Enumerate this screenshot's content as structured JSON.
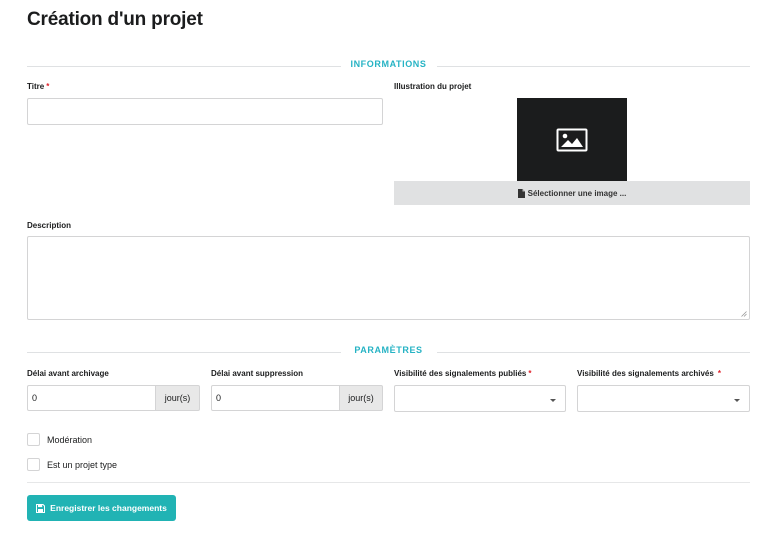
{
  "page": {
    "title": "Création d'un projet"
  },
  "sections": {
    "informations": "INFORMATIONS",
    "parametres": "PARAMÈTRES"
  },
  "fields": {
    "title": {
      "label": "Titre",
      "required_mark": "*",
      "value": ""
    },
    "illustration": {
      "label": "Illustration du projet",
      "button_label": "Sélectionner une image ..."
    },
    "description": {
      "label": "Description",
      "value": ""
    },
    "archive_delay": {
      "label": "Délai avant archivage",
      "value": "0",
      "unit": "jour(s)"
    },
    "delete_delay": {
      "label": "Délai avant suppression",
      "value": "0",
      "unit": "jour(s)"
    },
    "visibility_published": {
      "label": "Visibilité des signalements publiés",
      "required_mark": "*",
      "selected": ""
    },
    "visibility_archived": {
      "label": "Visibilité des signalements archivés",
      "required_mark": "*",
      "selected": ""
    }
  },
  "checkboxes": {
    "moderation": {
      "label": "Modération",
      "checked": false
    },
    "template": {
      "label": "Est un projet type",
      "checked": false
    }
  },
  "actions": {
    "save_label": "Enregistrer les changements"
  },
  "colors": {
    "accent": "#26b3c4",
    "button": "#21b3b4",
    "required": "#e0222b"
  },
  "icons": [
    "image-icon",
    "file-icon",
    "dropdown-caret-icon",
    "floppy-disk-icon",
    "resize-grip-icon"
  ]
}
